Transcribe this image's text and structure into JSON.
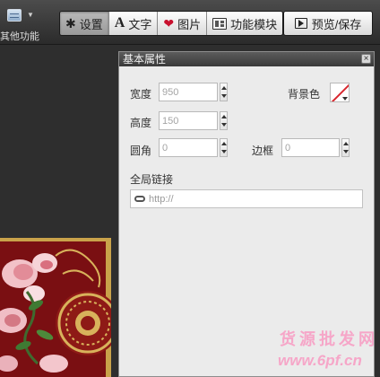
{
  "toolbar": {
    "other_functions_label": "其他功能",
    "settings_label": "设置",
    "text_label": "文字",
    "image_label": "图片",
    "modules_label": "功能模块",
    "preview_save_label": "预览/保存"
  },
  "panel": {
    "title": "基本属性",
    "close_glyph": "×",
    "width_label": "宽度",
    "width_value": "950",
    "height_label": "高度",
    "height_value": "150",
    "radius_label": "圆角",
    "radius_value": "0",
    "border_label": "边框",
    "border_value": "0",
    "bg_color_label": "背景色",
    "global_link_label": "全局链接",
    "global_link_placeholder": "http://"
  },
  "watermark": {
    "line1": "货源批发网",
    "line2": "www.6pf.cn"
  },
  "colors": {
    "toolbar_bg": "#3a3a3a",
    "panel_bg": "#ebebeb",
    "accent_red": "#c8102e",
    "watermark_pink": "#f6a6c8"
  },
  "icons": [
    "grid-menu-icon",
    "gear-icon",
    "font-a-icon",
    "heart-icon",
    "module-icon",
    "play-icon",
    "close-icon",
    "spinner-icon",
    "color-none-icon",
    "link-icon"
  ]
}
